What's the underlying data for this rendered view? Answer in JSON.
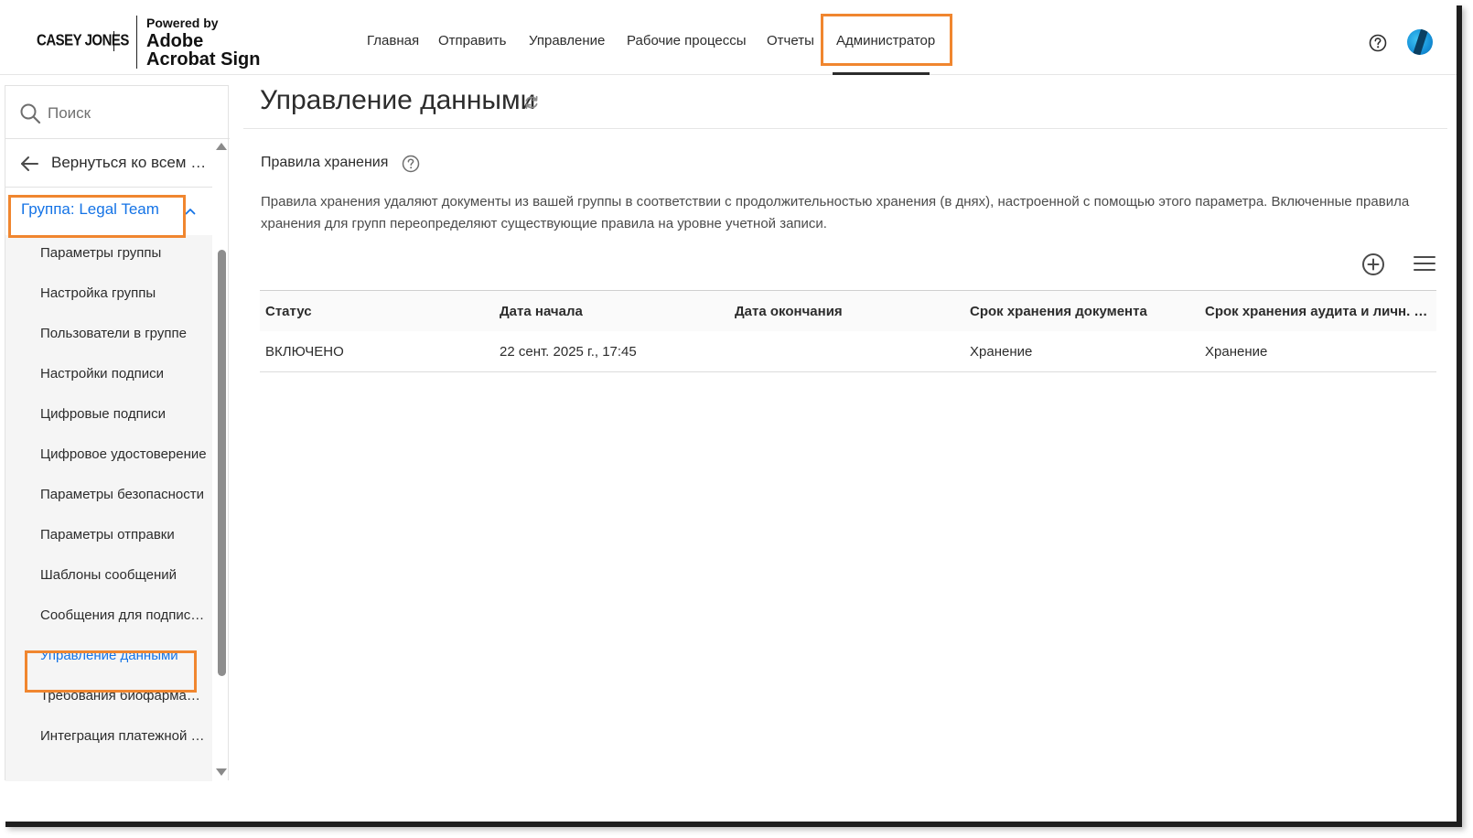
{
  "brand": {
    "client_logo": "CASEY JONES",
    "powered_by": "Powered by",
    "product_line1": "Adobe",
    "product_line2": "Acrobat Sign"
  },
  "nav": {
    "items": [
      {
        "label": "Главная"
      },
      {
        "label": "Отправить"
      },
      {
        "label": "Управление"
      },
      {
        "label": "Рабочие процессы"
      },
      {
        "label": "Отчеты"
      },
      {
        "label": "Администратор",
        "active": true
      }
    ],
    "help_icon": "help-circle-icon",
    "avatar_icon": "user-avatar"
  },
  "sidebar": {
    "search_placeholder": "Поиск",
    "back_label": "Вернуться ко всем группам",
    "group_label": "Группа: Legal Team",
    "items": [
      {
        "label": "Параметры группы"
      },
      {
        "label": "Настройка группы"
      },
      {
        "label": "Пользователи в группе"
      },
      {
        "label": "Настройки подписи"
      },
      {
        "label": "Цифровые подписи"
      },
      {
        "label": "Цифровое удостоверение"
      },
      {
        "label": "Параметры безопасности"
      },
      {
        "label": "Параметры отправки"
      },
      {
        "label": "Шаблоны сообщений"
      },
      {
        "label": "Сообщения для подписантов"
      },
      {
        "label": "Управление данными",
        "active": true
      },
      {
        "label": "Требования биофармацевтики"
      },
      {
        "label": "Интеграция платежной системы"
      }
    ]
  },
  "main": {
    "title": "Управление данными",
    "section_title": "Правила хранения",
    "description": "Правила хранения удаляют документы из вашей группы в соответствии с продолжительностью хранения (в днях), настроенной с помощью этого параметра. Включенные правила хранения для групп переопределяют существующие правила на уровне учетной записи.",
    "table": {
      "columns": [
        "Статус",
        "Дата начала",
        "Дата окончания",
        "Срок хранения документа",
        "Срок хранения аудита и личн. …"
      ],
      "rows": [
        [
          "ВКЛЮЧЕНО",
          "22 сент. 2025 г., 17:45",
          "",
          "Хранение",
          "Хранение"
        ]
      ]
    }
  },
  "colors": {
    "accent": "#1473e6",
    "highlight": "#f0862f",
    "text": "#2c2c2c"
  }
}
